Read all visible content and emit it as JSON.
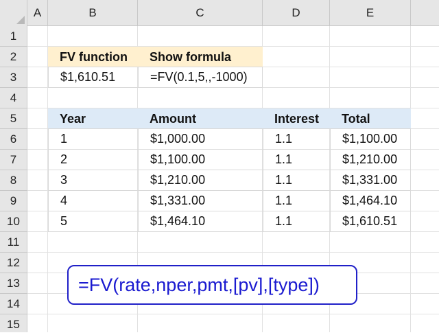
{
  "columns": [
    "A",
    "B",
    "C",
    "D",
    "E"
  ],
  "rows": [
    "1",
    "2",
    "3",
    "4",
    "5",
    "6",
    "7",
    "8",
    "9",
    "10",
    "11",
    "12",
    "13",
    "14",
    "15"
  ],
  "fv_table": {
    "headers": [
      "FV function",
      "Show formula"
    ],
    "values": [
      "$1,610.51",
      "=FV(0.1,5,,-1000)"
    ]
  },
  "calc_table": {
    "headers": [
      "Year",
      "Amount",
      "Interest",
      "Total"
    ],
    "rows": [
      [
        "1",
        "$1,000.00",
        "1.1",
        "$1,100.00"
      ],
      [
        "2",
        "$1,100.00",
        "1.1",
        "$1,210.00"
      ],
      [
        "3",
        "$1,210.00",
        "1.1",
        "$1,331.00"
      ],
      [
        "4",
        "$1,331.00",
        "1.1",
        "$1,464.10"
      ],
      [
        "5",
        "$1,464.10",
        "1.1",
        "$1,610.51"
      ]
    ]
  },
  "syntax": "=FV(rate,nper,pmt,[pv],[type])",
  "colors": {
    "header_yellow": "#fff0cf",
    "header_blue": "#ddeaf7",
    "syntax_blue": "#1a1ad0"
  }
}
